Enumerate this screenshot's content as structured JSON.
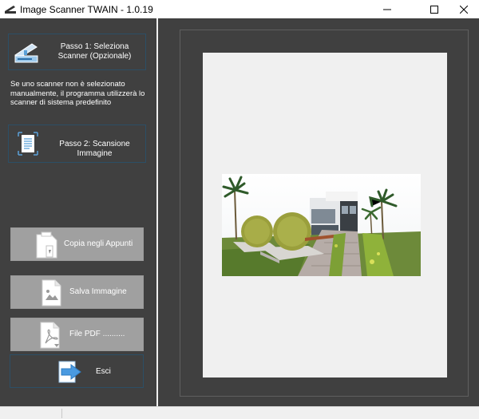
{
  "window": {
    "title": "Image Scanner TWAIN - 1.0.19"
  },
  "steps": {
    "step1_label": "Passo 1: Seleziona Scanner (Opzionale)",
    "info": "Se uno scanner non è selezionato manualmente, il programma utilizzerà lo scanner di sistema predefinito",
    "step2_label": "Passo 2: Scansione Immagine"
  },
  "actions": {
    "copy_label": "Copia negli Appunti",
    "save_label": "Salva Immagine",
    "pdf_label": "File PDF ..........",
    "exit_label": "Esci"
  },
  "icons": {
    "app": "scanner-icon",
    "step1": "scanner-icon",
    "step2": "document-scan-icon",
    "copy": "clipboard-icon",
    "save": "image-file-icon",
    "pdf": "pdf-file-icon",
    "exit": "arrow-right-icon"
  },
  "colors": {
    "panel_bg": "#404040",
    "accent_border": "#2c4f66",
    "disabled_button": "#a0a0a0",
    "page_sheet": "#f0f0f0"
  }
}
